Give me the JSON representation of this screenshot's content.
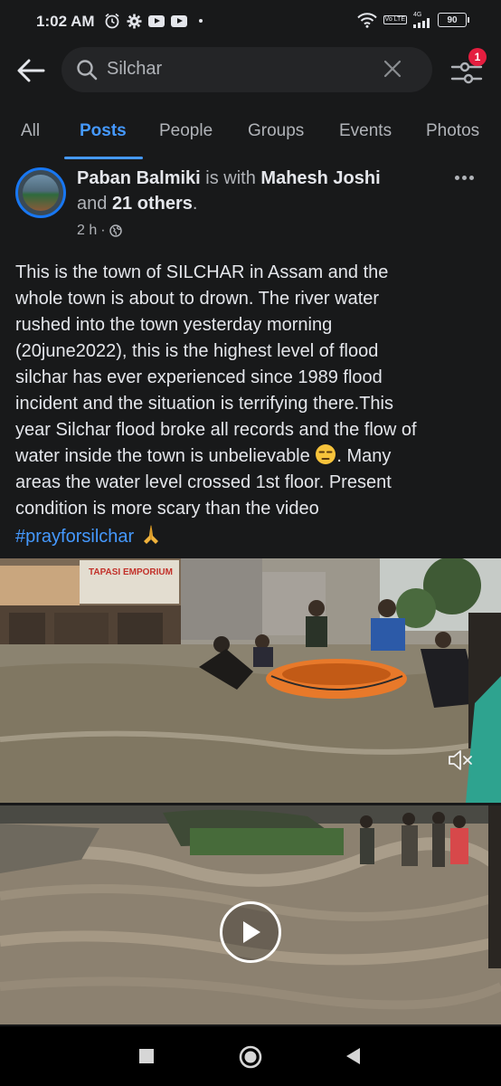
{
  "status_bar": {
    "time": "1:02 AM",
    "network_label": "4G",
    "volte_label": "Vo LTE",
    "battery": "90"
  },
  "search": {
    "query": "Silchar",
    "notification_count": "1"
  },
  "tabs": [
    {
      "label": "All"
    },
    {
      "label": "Posts"
    },
    {
      "label": "People"
    },
    {
      "label": "Groups"
    },
    {
      "label": "Events"
    },
    {
      "label": "Photos"
    }
  ],
  "post": {
    "author": "Paban Balmiki",
    "with_text": " is with ",
    "tagged": "Mahesh Joshi",
    "and_text": "and ",
    "others": "21 others",
    "period": ".",
    "time": "2 h",
    "body_lines": [
      "This is the town of SILCHAR in Assam and the",
      "whole town is about to drown. The river water",
      "rushed into the town yesterday morning",
      "(20june2022), this is the highest level of flood",
      "silchar has ever experienced since 1989 flood",
      "incident and the situation is terrifying there.This",
      "year Silchar flood broke all records and the flow of",
      "water inside the town is unbelievable",
      ". Many",
      "areas the water level crossed 1st floor. Present",
      "condition is more scary than the video"
    ],
    "hashtag": "#prayforsilchar",
    "video_sign_text": "TAPASI EMPORIUM"
  },
  "colors": {
    "accent": "#4599ff",
    "badge": "#e41e3f",
    "background": "#18191a"
  }
}
